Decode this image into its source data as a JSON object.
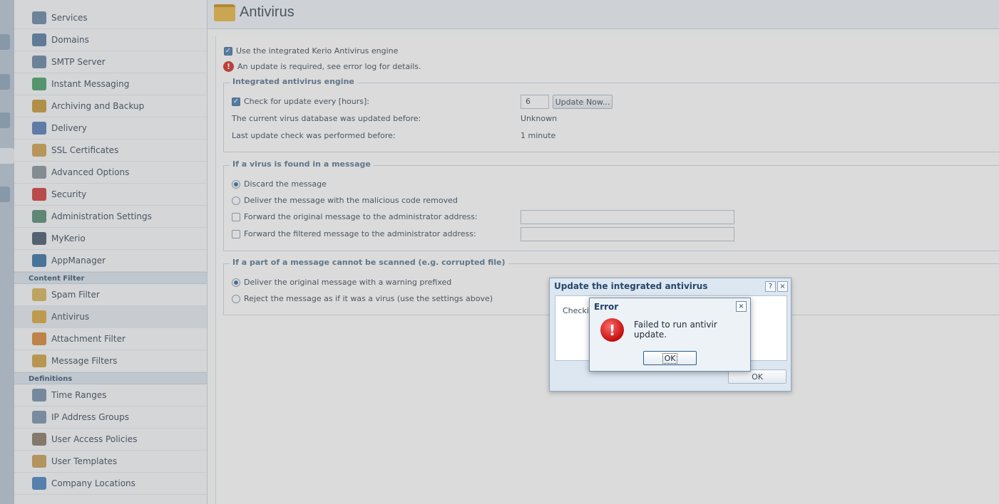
{
  "sidebar": {
    "items_top": [
      {
        "label": "Services",
        "icon": "services-icon",
        "color": "#6d8aa8"
      },
      {
        "label": "Domains",
        "icon": "at-icon",
        "color": "#5a7fa5"
      },
      {
        "label": "SMTP Server",
        "icon": "server-icon",
        "color": "#6b88a6"
      },
      {
        "label": "Instant Messaging",
        "icon": "chat-icon",
        "color": "#4ea06a"
      },
      {
        "label": "Archiving and Backup",
        "icon": "archive-icon",
        "color": "#c99a3c"
      },
      {
        "label": "Delivery",
        "icon": "delivery-icon",
        "color": "#5b7fb8"
      },
      {
        "label": "SSL Certificates",
        "icon": "certificate-icon",
        "color": "#d0a352"
      },
      {
        "label": "Advanced Options",
        "icon": "gear-icon",
        "color": "#8a959f"
      },
      {
        "label": "Security",
        "icon": "stop-hand-icon",
        "color": "#d33f3f"
      },
      {
        "label": "Administration Settings",
        "icon": "admin-icon",
        "color": "#5b8e78"
      },
      {
        "label": "MyKerio",
        "icon": "mykerio-icon",
        "color": "#4c5d70"
      },
      {
        "label": "AppManager",
        "icon": "appmanager-icon",
        "color": "#3b76a8"
      }
    ],
    "section_content_filter": "Content Filter",
    "items_content": [
      {
        "label": "Spam Filter",
        "icon": "spam-filter-icon",
        "color": "#d8b65c"
      },
      {
        "label": "Antivirus",
        "icon": "folder-icon",
        "color": "#d9a943"
      },
      {
        "label": "Attachment Filter",
        "icon": "attachment-icon",
        "color": "#d88a3b"
      },
      {
        "label": "Message Filters",
        "icon": "message-filter-icon",
        "color": "#d1a345"
      }
    ],
    "section_definitions": "Definitions",
    "items_definitions": [
      {
        "label": "Time Ranges",
        "icon": "clock-icon",
        "color": "#7992ab"
      },
      {
        "label": "IP Address Groups",
        "icon": "network-icon",
        "color": "#7c95ae"
      },
      {
        "label": "User Access Policies",
        "icon": "user-policy-icon",
        "color": "#8b7d6a"
      },
      {
        "label": "User Templates",
        "icon": "user-template-icon",
        "color": "#c9a158"
      },
      {
        "label": "Company Locations",
        "icon": "location-icon",
        "color": "#4c84c0"
      }
    ]
  },
  "page": {
    "title": "Antivirus"
  },
  "main": {
    "use_engine_label": "Use the integrated Kerio Antivirus engine",
    "warning_text": "An update is required, see error log for details.",
    "engine": {
      "legend": "Integrated antivirus engine",
      "check_label": "Check for update every [hours]:",
      "hours_value": "6",
      "update_button": "Update Now...",
      "db_label": "The current virus database was updated before:",
      "db_value": "Unknown",
      "last_label": "Last update check was performed before:",
      "last_value": "1 minute"
    },
    "virus_found": {
      "legend": "If a virus is found in a message",
      "discard": "Discard the message",
      "deliver_removed": "Deliver the message with the malicious code removed",
      "forward_original": "Forward the original message to the administrator address:",
      "forward_filtered": "Forward the filtered message to the administrator address:"
    },
    "cannot_scan": {
      "legend": "If a part of a message cannot be scanned (e.g. corrupted file)",
      "deliver_warning": "Deliver the original message with a warning prefixed",
      "reject": "Reject the message as if it was a virus (use the settings above)"
    }
  },
  "update_dialog": {
    "title": "Update the integrated antivirus",
    "help": "?",
    "close": "×",
    "body_text": "Checkin",
    "ok": "OK"
  },
  "error_dialog": {
    "title": "Error",
    "close": "×",
    "icon_glyph": "!",
    "message": "Failed to run antivir update.",
    "ok": "OK"
  }
}
